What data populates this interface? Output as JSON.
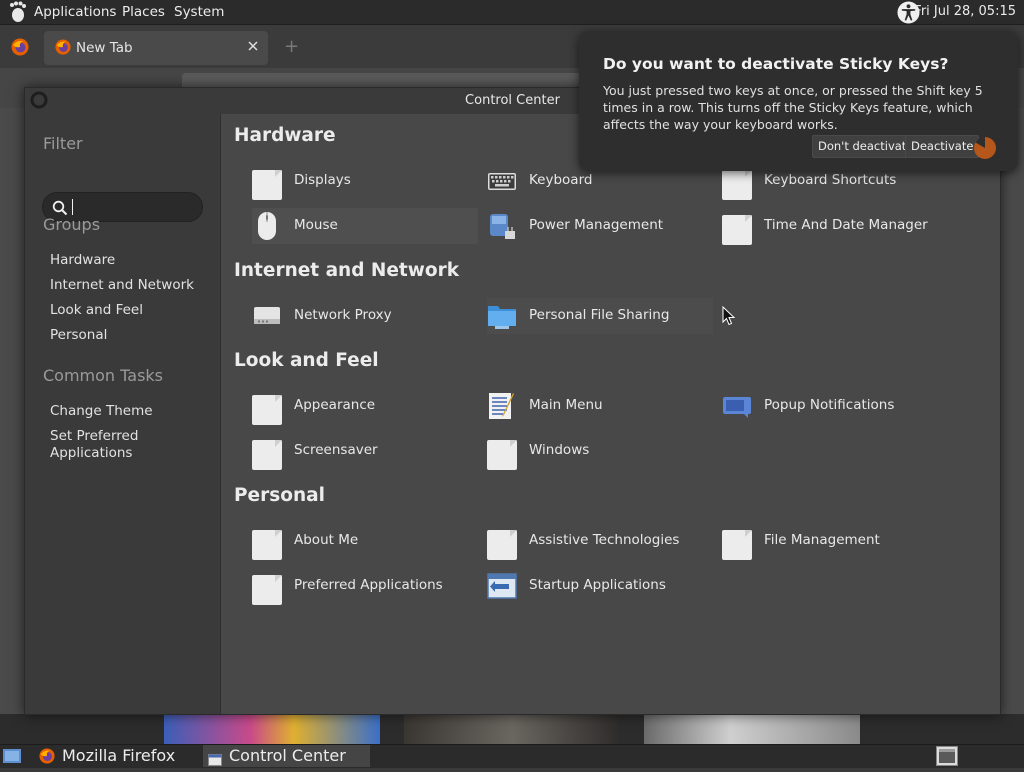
{
  "top_panel": {
    "menus": [
      "Applications",
      "Places",
      "System"
    ],
    "clock": "Fri Jul 28, 05:15"
  },
  "firefox": {
    "tab_title": "New Tab",
    "new_tab_symbol": "+"
  },
  "window": {
    "title": "Control Center"
  },
  "sidebar": {
    "filter_heading": "Filter",
    "search_value": "",
    "groups_heading": "Groups",
    "groups": [
      "Hardware",
      "Internet and Network",
      "Look and Feel",
      "Personal"
    ],
    "tasks_heading": "Common Tasks",
    "tasks": [
      "Change Theme",
      "Set Preferred Applications"
    ]
  },
  "sections": [
    {
      "title": "Hardware",
      "items": [
        {
          "label": "Displays",
          "icon": "doc-icon"
        },
        {
          "label": "Keyboard",
          "icon": "keyboard-icon"
        },
        {
          "label": "Keyboard Shortcuts",
          "icon": "doc-icon"
        },
        {
          "label": "Mouse",
          "icon": "mouse-icon"
        },
        {
          "label": "Power Management",
          "icon": "power-icon"
        },
        {
          "label": "Time And Date Manager",
          "icon": "doc-icon"
        }
      ]
    },
    {
      "title": "Internet and Network",
      "items": [
        {
          "label": "Network Proxy",
          "icon": "network-proxy-icon"
        },
        {
          "label": "Personal File Sharing",
          "icon": "folder-share-icon"
        }
      ]
    },
    {
      "title": "Look and Feel",
      "items": [
        {
          "label": "Appearance",
          "icon": "doc-icon"
        },
        {
          "label": "Main Menu",
          "icon": "main-menu-icon"
        },
        {
          "label": "Popup Notifications",
          "icon": "popup-icon"
        },
        {
          "label": "Screensaver",
          "icon": "doc-icon"
        },
        {
          "label": "Windows",
          "icon": "doc-icon"
        }
      ]
    },
    {
      "title": "Personal",
      "items": [
        {
          "label": "About Me",
          "icon": "doc-icon"
        },
        {
          "label": "Assistive Technologies",
          "icon": "doc-icon"
        },
        {
          "label": "File Management",
          "icon": "doc-icon"
        },
        {
          "label": "Preferred Applications",
          "icon": "doc-icon"
        },
        {
          "label": "Startup Applications",
          "icon": "startup-icon"
        }
      ]
    }
  ],
  "notification": {
    "title": "Do you want to deactivate Sticky Keys?",
    "body": "You just pressed two keys at once, or pressed the Shift key 5 times in a row.  This turns off the Sticky Keys feature, which affects the way your keyboard works.",
    "btn_dont": "Don't deactivate",
    "btn_deactivate": "Deactivate"
  },
  "taskbar": {
    "items": [
      "Mozilla Firefox",
      "Control Center"
    ]
  },
  "colors": {
    "accent_orange": "#e66000",
    "highlight": "#4f4f4f"
  }
}
